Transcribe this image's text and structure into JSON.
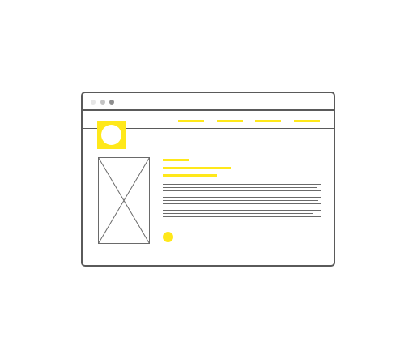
{
  "colors": {
    "accent": "#ffe81a",
    "frame": "#5a5a5a",
    "dots": [
      "#e6e6e6",
      "#c4c4c4",
      "#8f8f8f"
    ],
    "text_lines": "#6a6a6a"
  },
  "window": {
    "controls": [
      "close-dot",
      "minimize-dot",
      "maximize-dot"
    ]
  },
  "nav": {
    "link_count_visible": 4
  },
  "content": {
    "heading_lines": 3,
    "body_lines": 12
  }
}
